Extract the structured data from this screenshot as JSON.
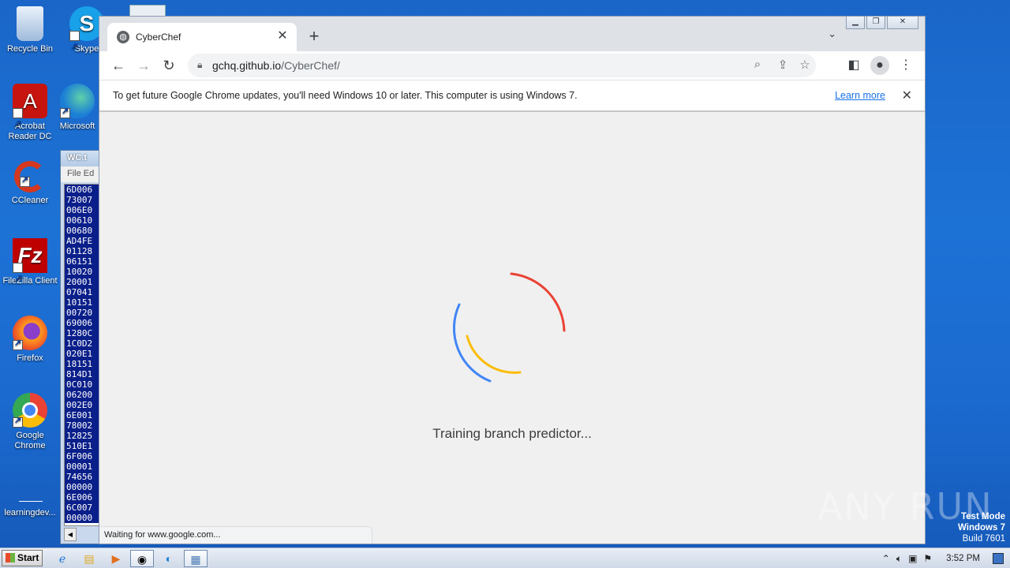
{
  "desktop": {
    "icons": [
      {
        "label": "Recycle Bin"
      },
      {
        "label": "Skype"
      },
      {
        "label": "Acrobat Reader DC"
      },
      {
        "label": "Microsoft"
      },
      {
        "label": "CCleaner"
      },
      {
        "label": "FileZilla Client"
      },
      {
        "label": "Firefox"
      },
      {
        "label": "Google Chrome"
      },
      {
        "label": "learningdev..."
      }
    ],
    "watermark": "ANY RUN",
    "test_mode": {
      "line1": "Test Mode",
      "line2": "Windows 7",
      "line3": "Build 7601"
    }
  },
  "notepad": {
    "title": "WC.t",
    "menu": "File  Ed",
    "lines": [
      "6D006",
      "73007",
      "006E0",
      "00610",
      "00680",
      "AD4FE",
      "01128",
      "06151",
      "10020",
      "20001",
      "07041",
      "10151",
      "00720",
      "69006",
      "1280C",
      "1C0D2",
      "020E1",
      "18151",
      "814D1",
      "0C010",
      "06200",
      "002E0",
      "6E001",
      "78002",
      "12825",
      "510E1",
      "6F006",
      "00001",
      "74656",
      "00000",
      "6E006",
      "6C007",
      "00000"
    ]
  },
  "browser": {
    "tab": {
      "title": "CyberChef",
      "favicon": "globe-icon"
    },
    "url_host": "gchq.github.io",
    "url_path": "/CyberChef/",
    "infobar": {
      "message": "To get future Google Chrome updates, you'll need Windows 10 or later. This computer is using Windows 7.",
      "link": "Learn more"
    },
    "loading_text": "Training branch predictor...",
    "status_text": "Waiting for www.google.com...",
    "spinner_colors": {
      "red": "#ea4335",
      "blue": "#4285f4",
      "yellow": "#fbbc05"
    }
  },
  "taskbar": {
    "start_label": "Start",
    "clock": "3:52 PM"
  }
}
